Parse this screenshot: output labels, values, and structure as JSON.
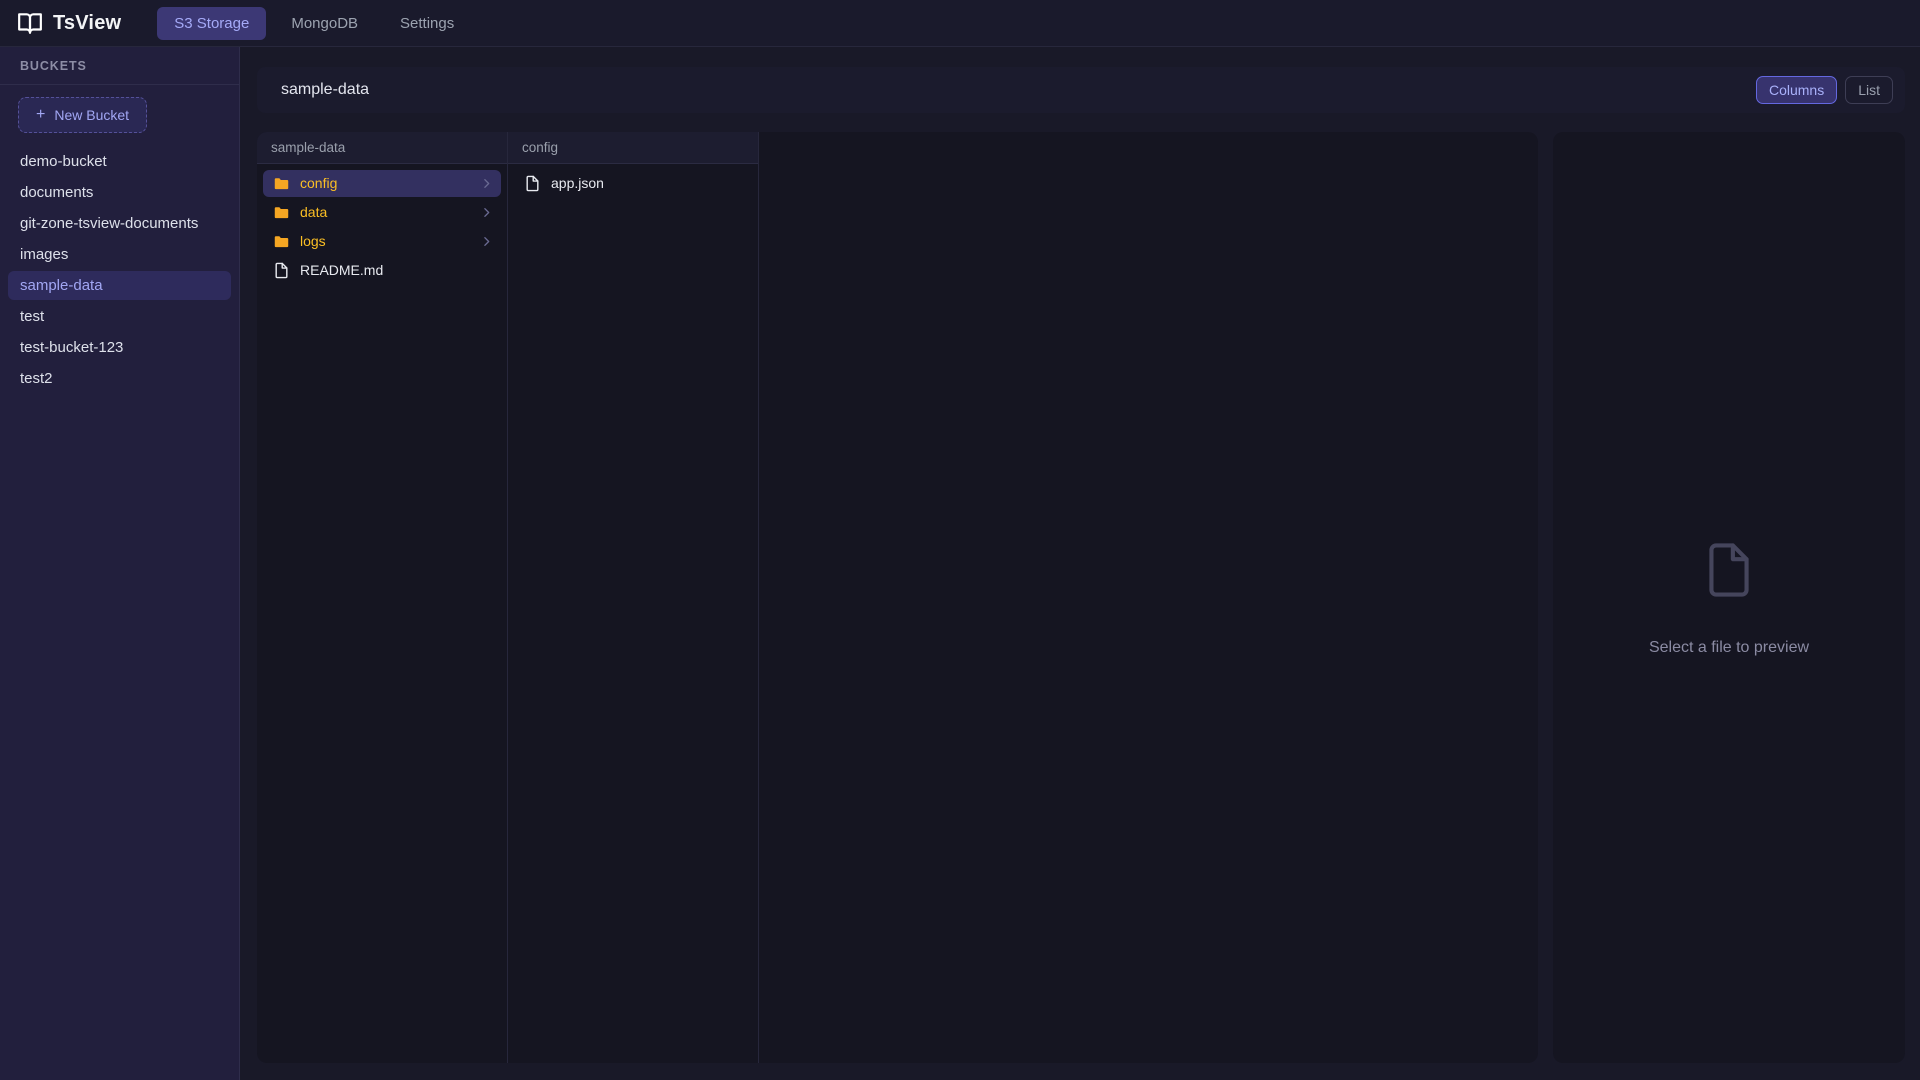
{
  "app": {
    "title": "TsView"
  },
  "topnav": {
    "tabs": [
      {
        "label": "S3 Storage",
        "active": true
      },
      {
        "label": "MongoDB",
        "active": false
      },
      {
        "label": "Settings",
        "active": false
      }
    ]
  },
  "sidebar": {
    "header": "BUCKETS",
    "plus_icon": "+",
    "new_bucket_label": "New Bucket",
    "buckets": [
      "demo-bucket",
      "documents",
      "git-zone-tsview-documents",
      "images",
      "sample-data",
      "test",
      "test-bucket-123",
      "test2"
    ],
    "selected_bucket": "sample-data"
  },
  "main": {
    "title": "sample-data",
    "view_toggle": {
      "columns_label": "Columns",
      "list_label": "List",
      "active": "Columns"
    },
    "columns": [
      {
        "header": "sample-data",
        "items": [
          {
            "name": "config",
            "type": "folder",
            "selected": true
          },
          {
            "name": "data",
            "type": "folder",
            "selected": false
          },
          {
            "name": "logs",
            "type": "folder",
            "selected": false
          },
          {
            "name": "README.md",
            "type": "file",
            "selected": false
          }
        ]
      },
      {
        "header": "config",
        "items": [
          {
            "name": "app.json",
            "type": "file",
            "selected": false
          }
        ]
      }
    ],
    "preview": {
      "placeholder": "Select a file to preview"
    }
  },
  "icons": {
    "logo": "book-open-icon",
    "new_bucket": "plus-icon",
    "folder": "folder-icon",
    "file": "file-icon",
    "folder_expand": "chevron-right-icon",
    "preview_placeholder": "file-outline-icon"
  },
  "colors": {
    "page_bg": "#191928",
    "topbar_bg": "#1a1a2c",
    "sidebar_bg": "#221f3d",
    "panel_bg": "#151521",
    "active_tab_bg": "#3c3875",
    "accent_indigo": "#a5aaf8",
    "folder_amber": "#fbbf24",
    "selected_row_bg": "#333060"
  }
}
